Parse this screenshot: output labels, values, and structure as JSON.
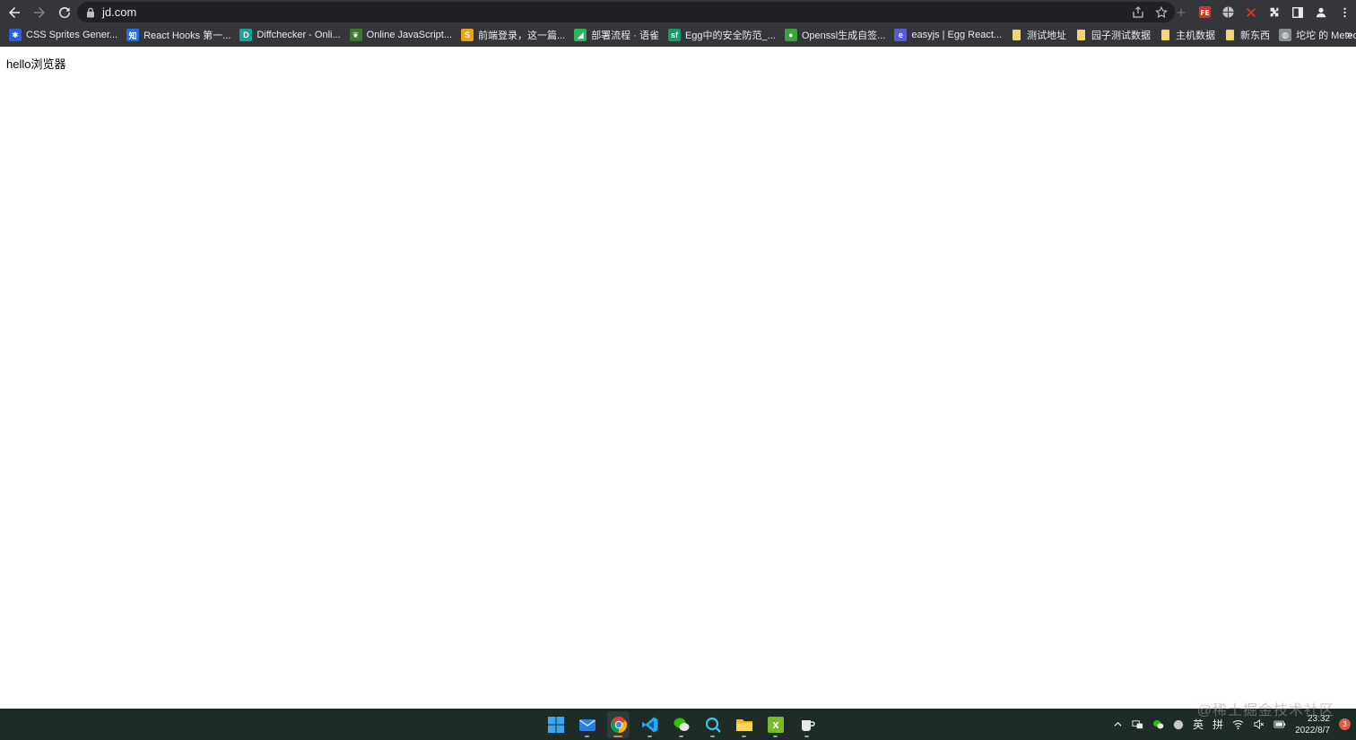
{
  "toolbar": {
    "url": "jd.com"
  },
  "bookmarks": [
    {
      "label": "CSS Sprites Gener...",
      "color": "#2b5fd9",
      "glyph": "✱"
    },
    {
      "label": "React Hooks 第一...",
      "color": "#1e6fe0",
      "glyph": "知"
    },
    {
      "label": "Diffchecker - Onli...",
      "color": "#16a39a",
      "glyph": "D"
    },
    {
      "label": "Online JavaScript...",
      "color": "#3c7a2f",
      "glyph": "❦"
    },
    {
      "label": "前端登录，这一篇...",
      "color": "#e8a317",
      "glyph": "S"
    },
    {
      "label": "部署流程 · 语雀",
      "color": "#2fb35a",
      "glyph": "◢"
    },
    {
      "label": "Egg中的安全防范_...",
      "color": "#139d6b",
      "glyph": "sf"
    },
    {
      "label": "Openssl生成自签...",
      "color": "#3aa33a",
      "glyph": "●"
    },
    {
      "label": "easyjs | Egg React...",
      "color": "#5b5bd6",
      "glyph": "e"
    },
    {
      "label": "测试地址",
      "color": "#f5d470",
      "glyph": ""
    },
    {
      "label": "园子测试数据",
      "color": "#f5d470",
      "glyph": ""
    },
    {
      "label": "主机数据",
      "color": "#f5d470",
      "glyph": ""
    },
    {
      "label": "新东西",
      "color": "#f5d470",
      "glyph": ""
    },
    {
      "label": "坨坨 的 MeteoNook",
      "color": "#8a8f94",
      "glyph": "◍"
    }
  ],
  "bookmarks_more": "»",
  "page": {
    "text": "hello浏览器"
  },
  "tray": {
    "lang": "英",
    "ime": "拼",
    "time": "23:32",
    "date": "2022/8/7",
    "notifications": "3"
  },
  "watermark": "@稀土掘金技术社区"
}
